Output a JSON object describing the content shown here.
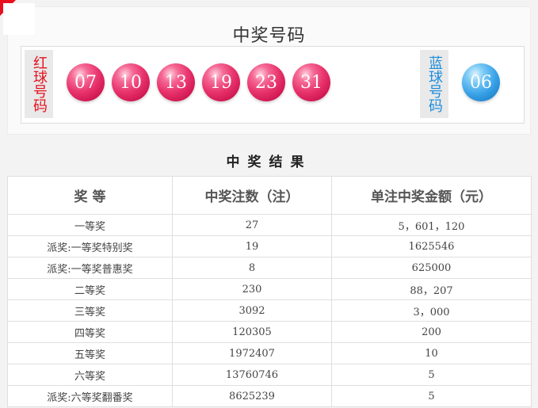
{
  "numbers": {
    "title": "中奖号码",
    "red_label": "红球号码",
    "blue_label": "蓝球号码",
    "red_balls": [
      "07",
      "10",
      "13",
      "19",
      "23",
      "31"
    ],
    "blue_ball": "06",
    "red_color": "#e3121f",
    "blue_color": "#1e8ddd"
  },
  "results": {
    "title": "中奖结果",
    "headers": [
      "奖  等",
      "中奖注数（注）",
      "单注中奖金额（元）"
    ],
    "rows": [
      [
        "一等奖",
        "27",
        "5，601，120"
      ],
      [
        "派奖:一等奖特别奖",
        "19",
        "1625546"
      ],
      [
        "派奖:一等奖普惠奖",
        "8",
        "625000"
      ],
      [
        "二等奖",
        "230",
        "88，207"
      ],
      [
        "三等奖",
        "3092",
        "3，000"
      ],
      [
        "四等奖",
        "120305",
        "200"
      ],
      [
        "五等奖",
        "1972407",
        "10"
      ],
      [
        "六等奖",
        "13760746",
        "5"
      ],
      [
        "派奖:六等奖翻番奖",
        "8625239",
        "5"
      ]
    ]
  }
}
